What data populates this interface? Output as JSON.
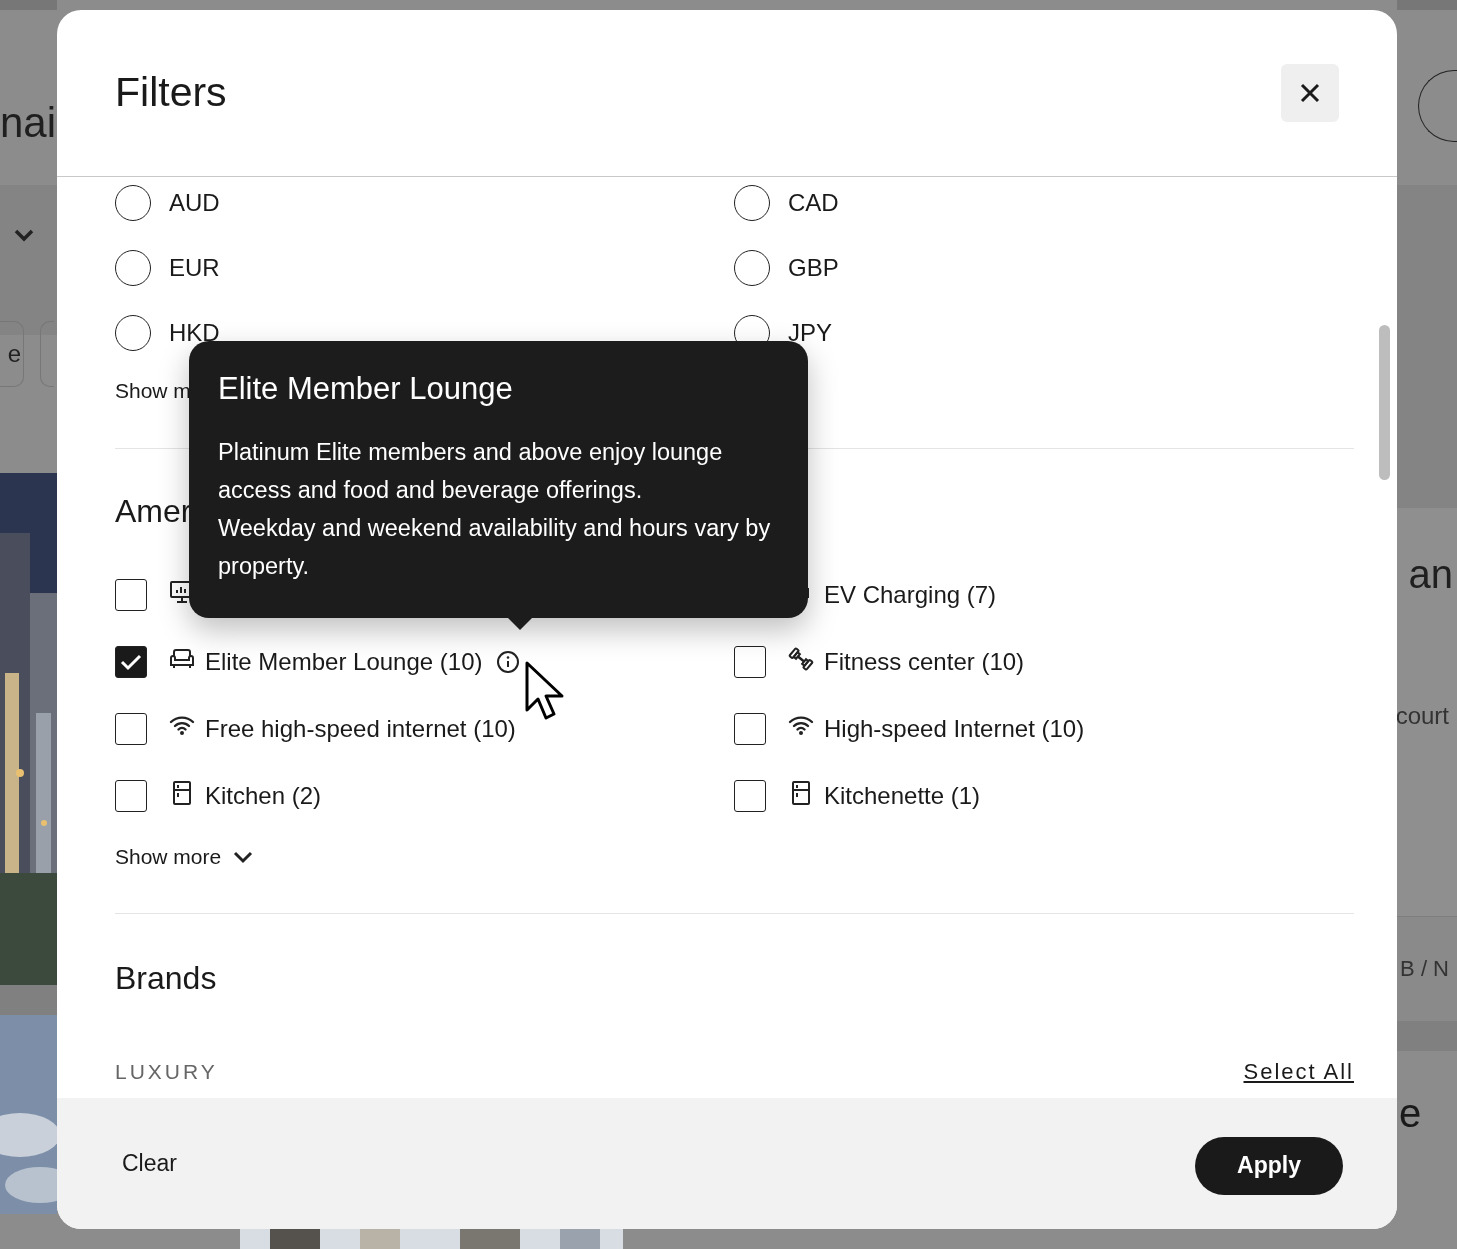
{
  "backdrop": {
    "left": {
      "heading": "nai",
      "chip": "e"
    },
    "right": {
      "card_title": "an",
      "card_text": "court",
      "card_footer": "B / N",
      "heading": "e"
    }
  },
  "dialog": {
    "title": "Filters"
  },
  "currency": {
    "options": [
      {
        "label": "AUD",
        "selected": false
      },
      {
        "label": "CAD",
        "selected": false
      },
      {
        "label": "EUR",
        "selected": false
      },
      {
        "label": "GBP",
        "selected": false
      },
      {
        "label": "HKD",
        "selected": false
      },
      {
        "label": "JPY",
        "selected": false
      }
    ],
    "show_more": "Show m"
  },
  "amenities": {
    "heading": "Amer",
    "items": [
      {
        "checked": false,
        "info": false
      },
      {
        "label": "EV Charging (7)",
        "info": false
      },
      {
        "label": "Elite Member Lounge (10)",
        "checked": true,
        "info": true
      },
      {
        "label": "Fitness center (10)",
        "checked": false,
        "info": false
      },
      {
        "label": "Free high-speed internet (10)",
        "checked": false,
        "info": false
      },
      {
        "label": "High-speed Internet (10)",
        "checked": false,
        "info": false
      },
      {
        "label": "Kitchen (2)",
        "checked": false,
        "info": false
      },
      {
        "label": "Kitchenette (1)",
        "checked": false,
        "info": false
      }
    ],
    "show_more": "Show more"
  },
  "brands": {
    "heading": "Brands",
    "groups": [
      {
        "label": "LUXURY",
        "action": "Select All"
      }
    ]
  },
  "footer": {
    "clear": "Clear",
    "apply": "Apply"
  },
  "tooltip": {
    "title": "Elite Member Lounge",
    "paragraphs": [
      "Platinum Elite members and above enjoy lounge access and food and beverage offerings.",
      "Weekday and weekend availability and hours vary by property."
    ]
  }
}
